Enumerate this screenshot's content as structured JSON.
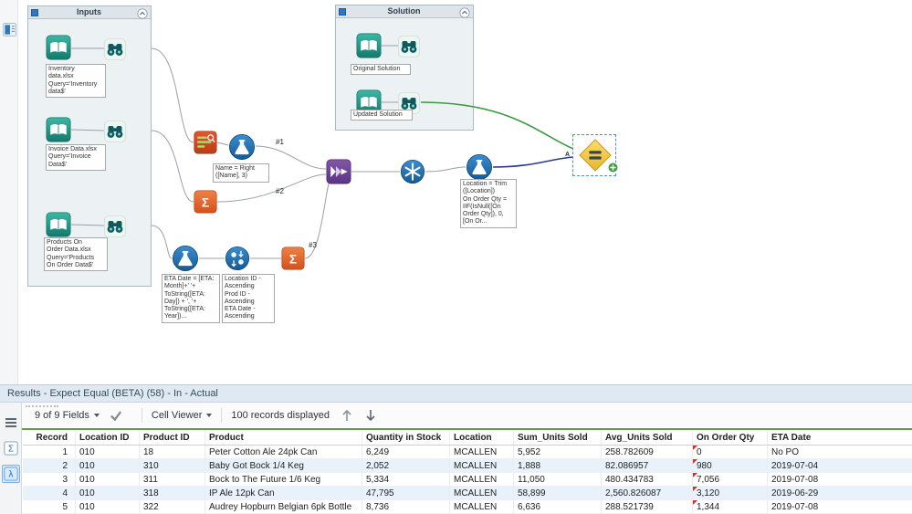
{
  "canvas": {
    "containers": [
      {
        "title": "Inputs"
      },
      {
        "title": "Solution"
      }
    ],
    "captions": [
      {
        "text": "Inventory\ndata.xlsx\nQuery='Inventory\ndata$'"
      },
      {
        "text": "Invoice Data.xlsx\nQuery='Invoice\nData$'"
      },
      {
        "text": "Products On\nOrder Data.xlsx\nQuery='Products\nOn Order Data$'"
      },
      {
        "text": "Original Solution"
      },
      {
        "text": "Updated Solution"
      },
      {
        "text": "Name = Right\n([Name], 3)"
      },
      {
        "text": "ETA Date = [ETA:\nMonth]+' '+\nToString([ETA:\nDay]) + ', '+\nToString([ETA:\nYear])..."
      },
      {
        "text": "Location ID -\nAscending\nProd ID -\nAscending\nETA Date -\nAscending"
      },
      {
        "text": "Location = Trim\n([Location])\nOn Order Qty =\nIIF(IsNull([On\nOrder Qty]), 0,\n[On Or..."
      }
    ],
    "connection_labels": [
      "#1",
      "#2",
      "#3"
    ],
    "test_anchor_label": "A"
  },
  "results": {
    "title": "Results - Expect Equal (BETA) (58) - In - Actual",
    "toolbar": {
      "fields_label": "9 of 9 Fields",
      "cell_viewer_label": "Cell Viewer",
      "records_label": "100 records displayed"
    },
    "table": {
      "columns": [
        "Record",
        "Location ID",
        "Product ID",
        "Product",
        "Quantity in Stock",
        "Location",
        "Sum_Units Sold",
        "Avg_Units Sold",
        "On Order Qty",
        "ETA Date"
      ],
      "rows": [
        [
          "1",
          "010",
          "18",
          "Peter Cotton Ale 24pk Can",
          "6,249",
          "MCALLEN",
          "5,952",
          "258.782609",
          "0",
          "No PO"
        ],
        [
          "2",
          "010",
          "310",
          "Baby Got Bock 1/4 Keg",
          "2,052",
          "MCALLEN",
          "1,888",
          "82.086957",
          "980",
          "2019-07-04"
        ],
        [
          "3",
          "010",
          "311",
          "Bock to The Future 1/6 Keg",
          "5,334",
          "MCALLEN",
          "11,050",
          "480.434783",
          "7,056",
          "2019-07-08"
        ],
        [
          "4",
          "010",
          "318",
          "IP Ale 12pk Can",
          "47,795",
          "MCALLEN",
          "58,899",
          "2,560.826087",
          "3,120",
          "2019-06-29"
        ],
        [
          "5",
          "010",
          "322",
          "Audrey Hopburn Belgian 6pk Bottle",
          "8,736",
          "MCALLEN",
          "6,636",
          "288.521739",
          "1,344",
          "2019-07-08"
        ]
      ]
    }
  },
  "icons": {
    "sigma": "Σ",
    "lambda": "λ"
  },
  "colors": {
    "accent_green": "#5f9e3e",
    "wire_green": "#3f9b41",
    "wire_navy": "#2b3a8f",
    "marker_red": "#d93025"
  }
}
